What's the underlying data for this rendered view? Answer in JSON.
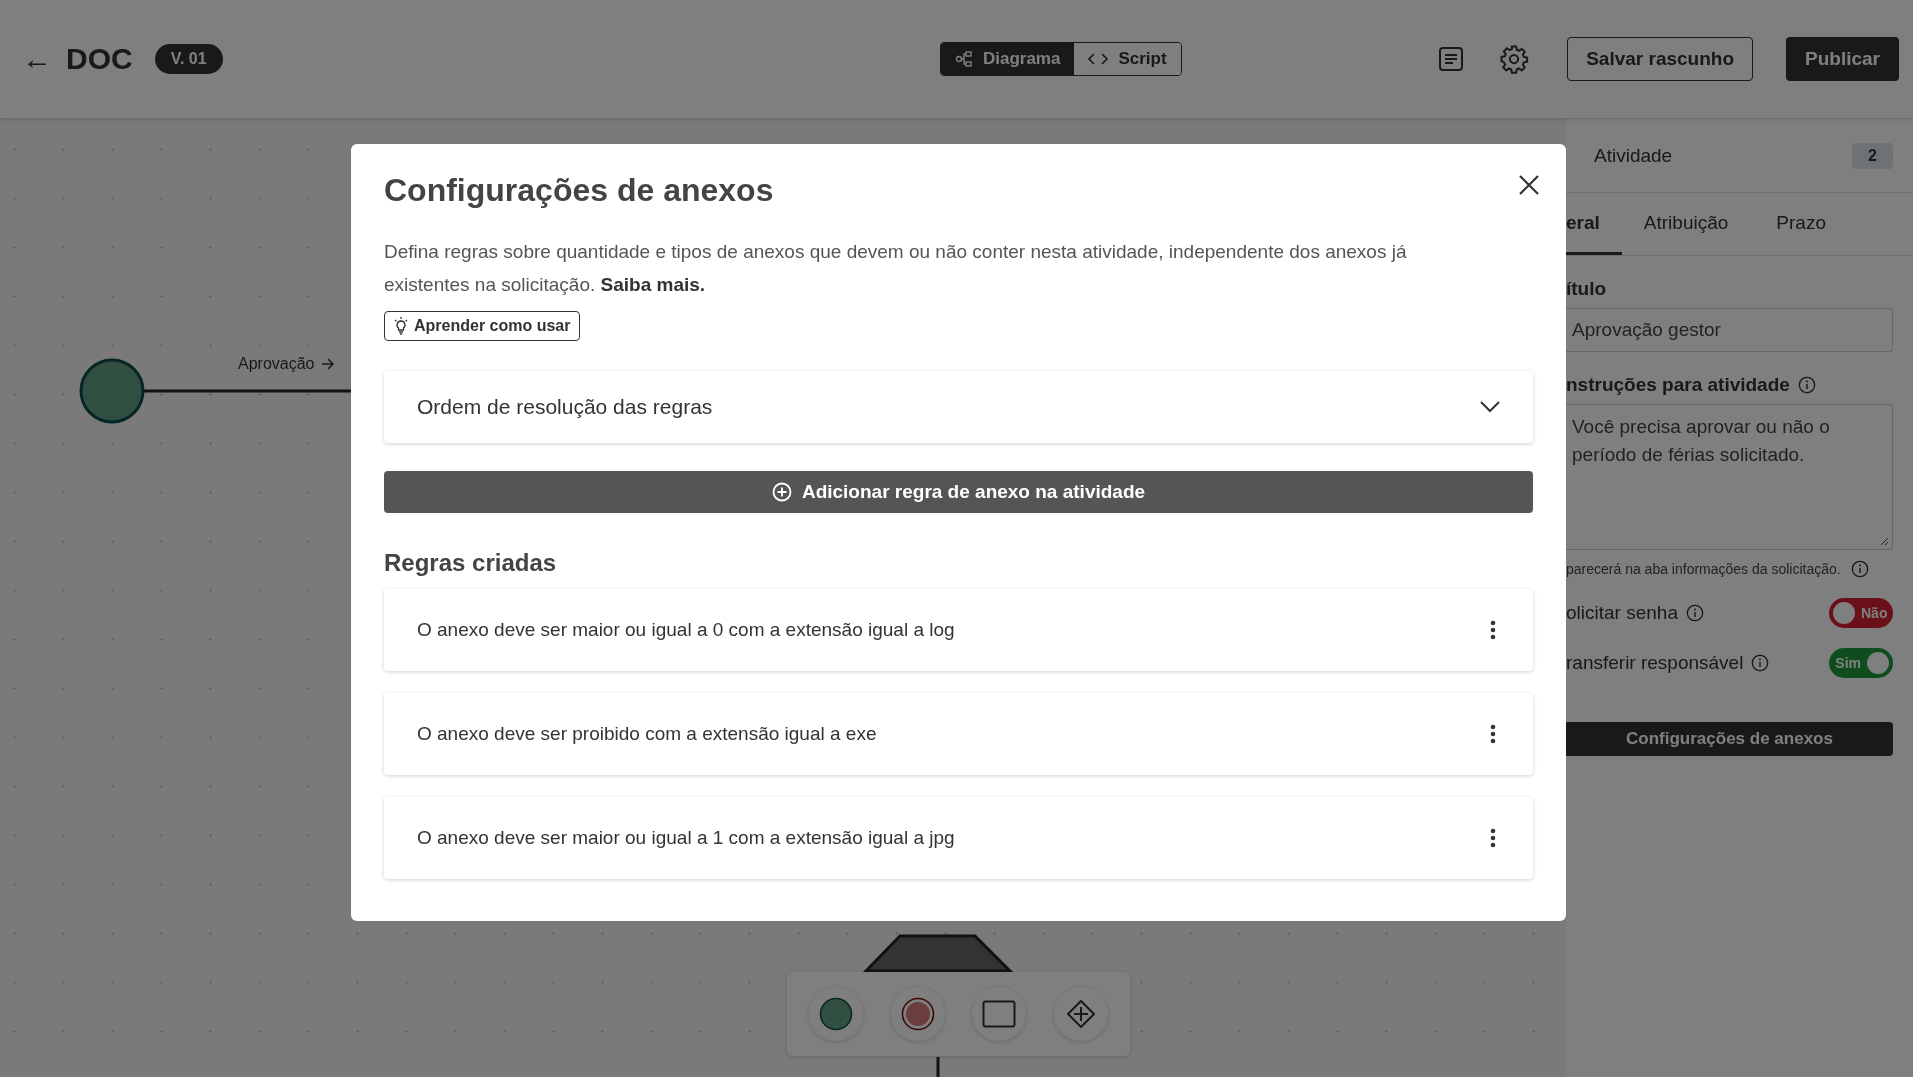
{
  "header": {
    "back": "←",
    "title": "DOC",
    "version": "V. 01",
    "view_tabs": [
      {
        "label": "Diagrama",
        "kind": "diagram",
        "selected": true
      },
      {
        "label": "Script",
        "kind": "code",
        "selected": false
      }
    ],
    "save_button": "Salvar rascunho",
    "publish_button": "Publicar"
  },
  "canvas": {
    "edge_label": "Aprovação"
  },
  "panel": {
    "title": "Atividade",
    "count": "2",
    "tabs": [
      {
        "label": "eral",
        "selected": true
      },
      {
        "label": "Atribuição",
        "selected": false
      },
      {
        "label": "Prazo",
        "selected": false
      }
    ],
    "title_label": "ítulo",
    "title_value": "Aprovação gestor",
    "instructions_label": "nstruções para atividade",
    "instructions_value": "Você precisa aprovar ou não o período de férias solicitado.",
    "hint": "parecerá na aba informações da solicitação.",
    "toggles": [
      {
        "label": "olicitar senha",
        "on": false,
        "text": "Não"
      },
      {
        "label": "ransferir responsável",
        "on": true,
        "text": "Sim"
      }
    ],
    "attachments_button": "Configurações de anexos"
  },
  "modal": {
    "title": "Configurações de anexos",
    "description": "Defina regras sobre quantidade e tipos de anexos que devem ou não conter nesta atividade, independente dos anexos já existentes na solicitação. **Saiba mais.**",
    "learn_button": "Aprender como usar",
    "accordion": {
      "label": "Ordem de resolução das regras",
      "expanded": false
    },
    "add_button": "Adicionar regra de anexo na atividade",
    "rules_heading": "Regras criadas",
    "rules": [
      {
        "text": "O anexo deve ser maior ou igual a 0 com a extensão igual a log"
      },
      {
        "text": "O anexo deve ser proibido com a extensão igual a exe"
      },
      {
        "text": "O anexo deve ser maior ou igual a 1 com a extensão igual a jpg"
      }
    ]
  }
}
